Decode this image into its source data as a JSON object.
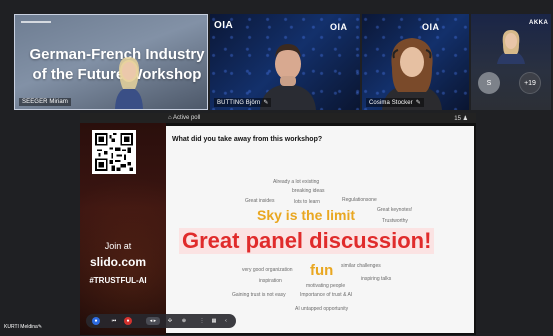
{
  "tiles": [
    {
      "name": "SEEGER Miriam",
      "stage_title": "German-French Industry of the Future Workshop"
    },
    {
      "name": "BUTTING Björn",
      "brand": "OIA"
    },
    {
      "name": "Cosima Stocker",
      "brand": "OIA"
    },
    {
      "name": "",
      "brand": "AKKA"
    }
  ],
  "participants": {
    "avatar_initial": "S",
    "more_count": "+19"
  },
  "slide_header": {
    "active_poll": "Active poll",
    "count": "15"
  },
  "slide": {
    "join_text": "Join at",
    "site": "slido.com",
    "hashtag": "#TRUSTFUL-AI",
    "question": "What did you take away from this workshop?"
  },
  "words": [
    {
      "t": "Already a lot existing"
    },
    {
      "t": "breaking ideas"
    },
    {
      "t": "Great insides"
    },
    {
      "t": "lots to learn"
    },
    {
      "t": "Regulationsone"
    },
    {
      "t": "Great keynotes!"
    },
    {
      "t": "Sky is the limit"
    },
    {
      "t": "Trustworthy"
    },
    {
      "t": "Great panel discussion!"
    },
    {
      "t": "very good organization"
    },
    {
      "t": "fun"
    },
    {
      "t": "similar challenges"
    },
    {
      "t": "inspiration"
    },
    {
      "t": "inspiring talks"
    },
    {
      "t": "motivating people"
    },
    {
      "t": "Gaining trust is not easy"
    },
    {
      "t": "Importance of trust & AI"
    },
    {
      "t": "AI untapped opportunity"
    }
  ],
  "bottom_name": "KURTI Meldina",
  "colors": {
    "accent_red": "#e02b2b",
    "accent_gold": "#e9a721",
    "bg": "#1f2023"
  }
}
